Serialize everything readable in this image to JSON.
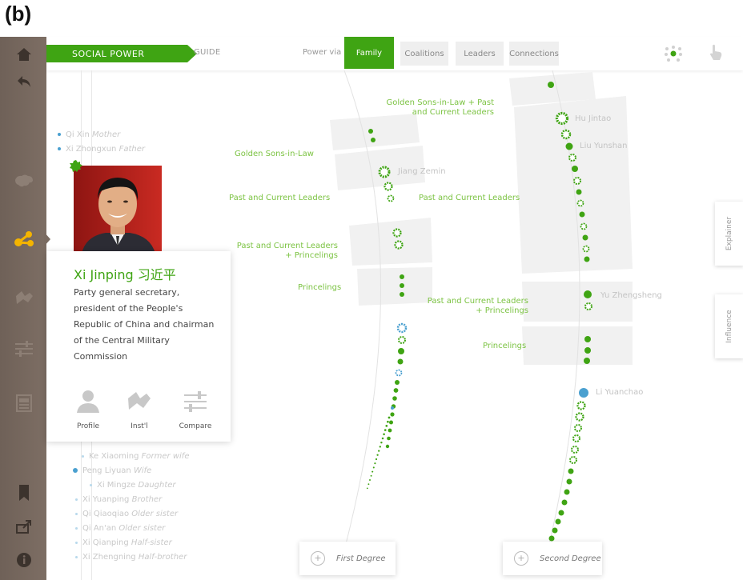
{
  "figure_label": "(b)",
  "header": {
    "app_name": "SOCIAL POWER",
    "guide_label": "GUIDE",
    "power_via_label": "Power via",
    "tabs": [
      {
        "label": "Family",
        "active": true
      },
      {
        "label": "Coalitions",
        "active": false
      },
      {
        "label": "Leaders",
        "active": false
      },
      {
        "label": "Connections",
        "active": false
      }
    ]
  },
  "sidebar": {
    "icons": [
      "home-icon",
      "back-icon",
      "map-icon",
      "network-icon",
      "institution-icon",
      "compare-sliders-icon",
      "newspaper-icon",
      "bookmark-icon",
      "share-icon",
      "info-icon"
    ],
    "active_icon": "network-icon"
  },
  "family_list_top": [
    {
      "name": "Qi Xin",
      "relation": "Mother"
    },
    {
      "name": "Xi Zhongxun",
      "relation": "Father"
    }
  ],
  "family_list_bottom": [
    {
      "name": "Ke Xiaoming",
      "relation": "Former wife",
      "indent": 0
    },
    {
      "name": "Peng Liyuan",
      "relation": "Wife",
      "indent": 0
    },
    {
      "name": "Xi Mingze",
      "relation": "Daughter",
      "indent": 1
    },
    {
      "name": "Xi Yuanping",
      "relation": "Brother",
      "indent": 0
    },
    {
      "name": "Qi Qiaoqiao",
      "relation": "Older sister",
      "indent": 0
    },
    {
      "name": "Qi An'an",
      "relation": "Older sister",
      "indent": 0
    },
    {
      "name": "Xi Qianping",
      "relation": "Half-sister",
      "indent": 0
    },
    {
      "name": "Xi Zhengning",
      "relation": "Half-brother",
      "indent": 0
    }
  ],
  "profile_card": {
    "name": "Xi Jinping 习近平",
    "description": "Party general secretary, president of the People's Republic of China and chairman of the Central Military Commission",
    "actions": [
      {
        "label": "Profile",
        "icon": "person-icon"
      },
      {
        "label": "Inst'l",
        "icon": "institution-icon"
      },
      {
        "label": "Compare",
        "icon": "compare-sliders-icon"
      }
    ]
  },
  "first_degree_labels": [
    "Golden Sons-in-Law",
    "Past and Current Leaders",
    "Past and Current Leaders + Princelings",
    "Princelings"
  ],
  "second_degree_labels": [
    "Golden Sons-in-Law + Past and Current Leaders",
    "Past and Current Leaders",
    "Past and Current Leaders + Princelings",
    "Princelings"
  ],
  "leaders": [
    "Jiang Zemin",
    "Hu Jintao",
    "Liu Yunshan",
    "Yu Zhengsheng",
    "Li Yuanchao"
  ],
  "right_tabs": [
    "Explainer",
    "Influence"
  ],
  "degree_buttons": [
    "First Degree",
    "Second Degree"
  ],
  "colors": {
    "accent_green": "#3fa413",
    "light_green": "#7cc343",
    "blue": "#4aa0d0",
    "sidebar": "#776860"
  }
}
